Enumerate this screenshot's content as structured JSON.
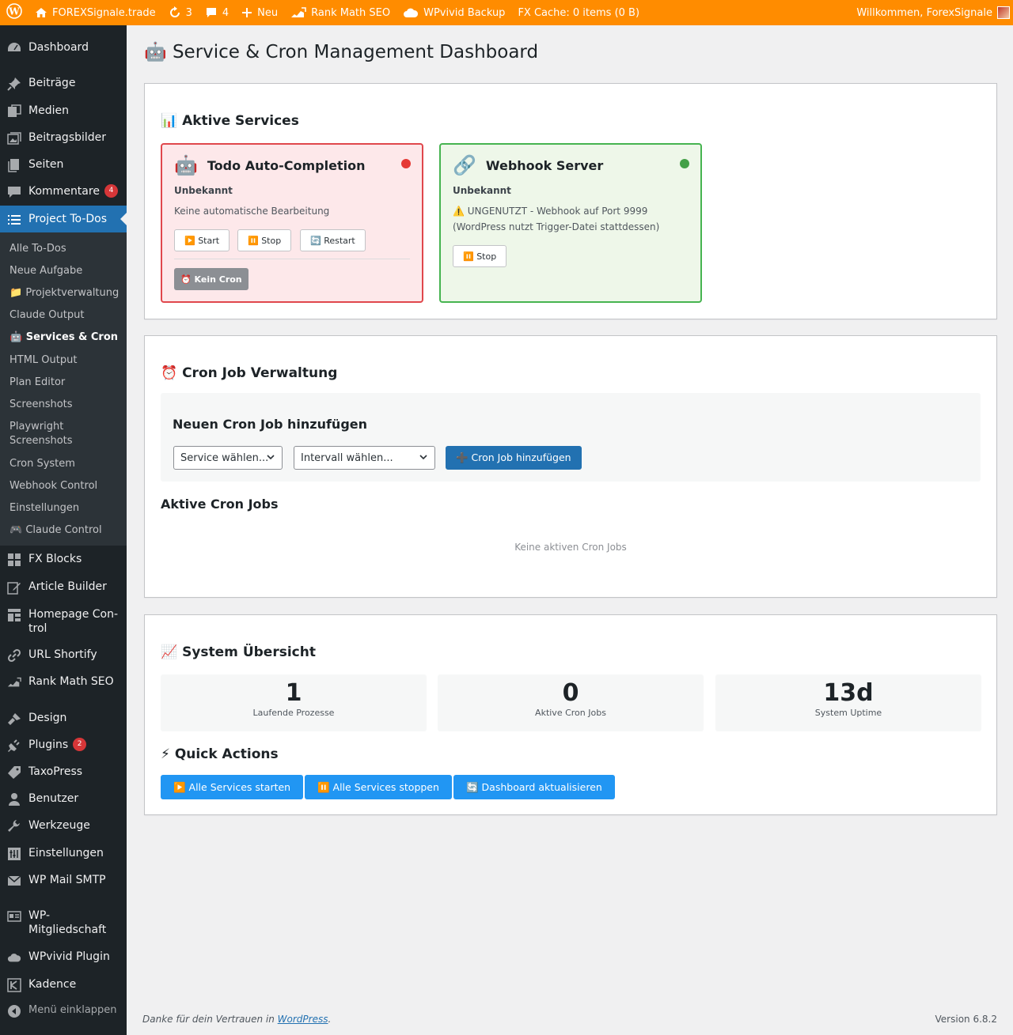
{
  "adminbar": {
    "site_name": "FOREXSignale.trade",
    "updates_count": "3",
    "comments_count": "4",
    "new_label": "Neu",
    "rankmath_label": "Rank Math SEO",
    "wpvivid_label": "WPvivid Backup",
    "fx_cache_label": "FX Cache: 0 items (0 B)",
    "welcome": "Willkommen, ForexSignale"
  },
  "sidebar": {
    "dashboard": "Dashboard",
    "beitraege": "Beiträge",
    "medien": "Medien",
    "beitragsbilder": "Beitragsbilder",
    "seiten": "Seiten",
    "kommentare": "Kommentare",
    "kommentare_badge": "4",
    "project_todos": "Project To-Dos",
    "submenu": {
      "alle_todos": "Alle To-Dos",
      "neue_aufgabe": "Neue Aufgabe",
      "projektverwaltung": "📁 Projektverwaltung",
      "claude_output": "Claude Output",
      "services_cron": "🤖 Services & Cron",
      "html_output": "HTML Output",
      "plan_editor": "Plan Editor",
      "screenshots": "Screenshots",
      "playwright_1": "Playwright",
      "playwright_2": "Screenshots",
      "cron_system": "Cron System",
      "webhook_control": "Webhook Control",
      "einstellungen": "Einstellungen",
      "claude_control": "🎮 Claude Control"
    },
    "fx_blocks": "FX Blocks",
    "article_builder": "Article Builder",
    "homepage_1": "Homepage Con-",
    "homepage_2": "trol",
    "url_shortify": "URL Shortify",
    "rank_math": "Rank Math SEO",
    "design": "Design",
    "plugins": "Plugins",
    "plugins_badge": "2",
    "taxopress": "TaxoPress",
    "benutzer": "Benutzer",
    "werkzeuge": "Werkzeuge",
    "einstellungen": "Einstellungen",
    "wp_mail_smtp": "WP Mail SMTP",
    "wp_mitglied_1": "WP-",
    "wp_mitglied_2": "Mitgliedschaft",
    "wpvivid_plugin": "WPvivid Plugin",
    "kadence": "Kadence",
    "collapse": "Menü einklappen"
  },
  "page": {
    "title": "🤖 Service & Cron Management Dashboard"
  },
  "services": {
    "heading": "📊 Aktive Services",
    "todo": {
      "emoji": "🤖",
      "title": "Todo Auto-Completion",
      "status": "Unbekannt",
      "desc": "Keine automatische Bearbeitung",
      "start": "▶️ Start",
      "stop": "⏸️ Stop",
      "restart": "🔄 Restart",
      "cron_badge": "⏰ Kein Cron",
      "dot_color": "#e53935"
    },
    "webhook": {
      "emoji": "🔗",
      "title": "Webhook Server",
      "status": "Unbekannt",
      "desc_1": "⚠️ UNGENUTZT - Webhook auf Port 9999",
      "desc_2": "(WordPress nutzt Trigger-Datei stattdessen)",
      "stop": "⏸️ Stop",
      "dot_color": "#43a047"
    }
  },
  "cron": {
    "heading": "⏰ Cron Job Verwaltung",
    "add_heading": "Neuen Cron Job hinzufügen",
    "service_select": "Service wählen...",
    "interval_select": "Intervall wählen...",
    "add_button": "➕ Cron Job hinzufügen",
    "active_heading": "Aktive Cron Jobs",
    "empty": "Keine aktiven Cron Jobs"
  },
  "system": {
    "heading": "📈 System Übersicht",
    "stats": [
      {
        "value": "1",
        "label": "Laufende Prozesse"
      },
      {
        "value": "0",
        "label": "Aktive Cron Jobs"
      },
      {
        "value": "13d",
        "label": "System Uptime"
      }
    ],
    "quick_heading": "⚡ Quick Actions",
    "start_all": "▶️ Alle Services starten",
    "stop_all": "⏸️ Alle Services stoppen",
    "refresh": "🔄 Dashboard aktualisieren"
  },
  "footer": {
    "thanks_prefix": "Danke für dein Vertrauen in ",
    "wordpress_link": "WordPress",
    "thanks_suffix": ".",
    "version": "Version 6.8.2"
  },
  "colors": {
    "adminbar": "#ff8c00",
    "sidebar": "#1d2327",
    "accent": "#2271b1"
  }
}
